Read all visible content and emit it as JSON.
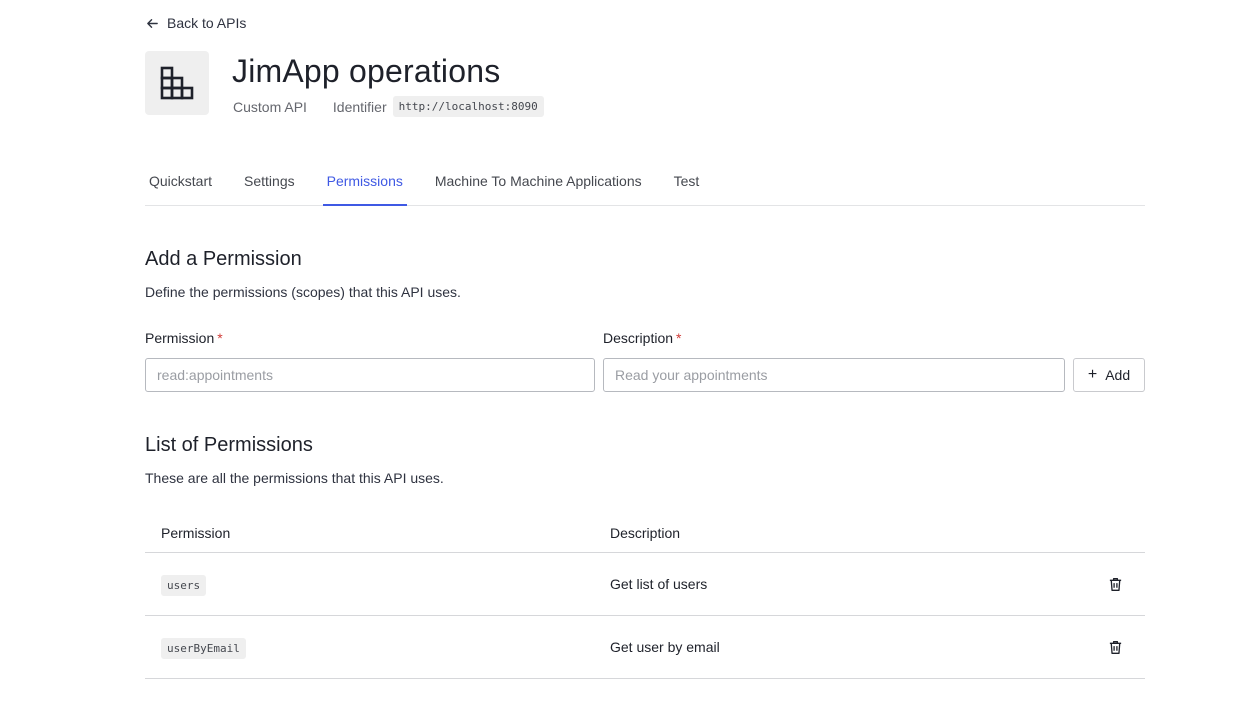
{
  "header": {
    "back_label": "Back to APIs",
    "api_icon": "building-icon",
    "api_name": "JimApp operations",
    "api_type": "Custom API",
    "identifier_label": "Identifier",
    "identifier_value": "http://localhost:8090"
  },
  "tabs": [
    {
      "label": "Quickstart",
      "active": false
    },
    {
      "label": "Settings",
      "active": false
    },
    {
      "label": "Permissions",
      "active": true
    },
    {
      "label": "Machine To Machine Applications",
      "active": false
    },
    {
      "label": "Test",
      "active": false
    }
  ],
  "add_section": {
    "title": "Add a Permission",
    "description": "Define the permissions (scopes) that this API uses.",
    "permission_label": "Permission",
    "permission_placeholder": "read:appointments",
    "description_label": "Description",
    "description_placeholder": "Read your appointments",
    "required_marker": "*",
    "add_button_label": "Add"
  },
  "list_section": {
    "title": "List of Permissions",
    "description": "These are all the permissions that this API uses.",
    "columns": [
      "Permission",
      "Description"
    ],
    "rows": [
      {
        "permission": "users",
        "description": "Get list of users"
      },
      {
        "permission": "userByEmail",
        "description": "Get user by email"
      }
    ]
  },
  "colors": {
    "accent": "#3f59e4",
    "required": "#d03c38"
  }
}
